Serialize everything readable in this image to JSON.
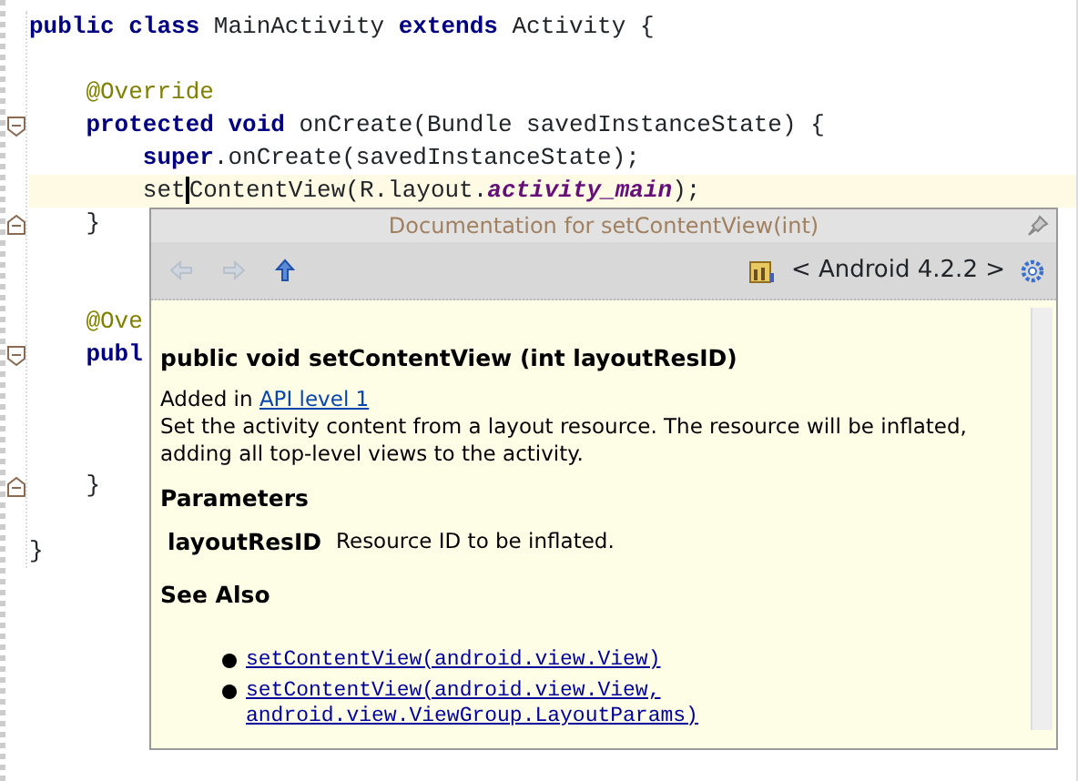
{
  "code_lines": [
    {
      "kind": "plain",
      "current": false,
      "tokens": [
        {
          "kind": "keyword",
          "text": "public class"
        },
        {
          "kind": "plain",
          "text": " MainActivity "
        },
        {
          "kind": "keyword",
          "text": "extends"
        },
        {
          "kind": "plain",
          "text": " Activity {"
        }
      ]
    },
    {
      "kind": "plain"
    },
    {
      "kind": "plain",
      "current": false,
      "tokens": [
        {
          "kind": "annotation",
          "text": "    @Override"
        }
      ]
    },
    {
      "kind": "fold-start",
      "current": false,
      "tokens": [
        {
          "kind": "keyword",
          "text": "    protected void"
        },
        {
          "kind": "plain",
          "text": " onCreate(Bundle savedInstanceState) {"
        }
      ]
    },
    {
      "kind": "plain",
      "current": false,
      "tokens": [
        {
          "kind": "keyword",
          "text": "        super"
        },
        {
          "kind": "plain",
          "text": ".onCreate(savedInstanceState);"
        }
      ]
    },
    {
      "kind": "plain",
      "current": true,
      "tokens": [
        {
          "kind": "plain",
          "text": "        set"
        },
        {
          "kind": "caret"
        },
        {
          "kind": "plain",
          "text": "ContentView(R.layout."
        },
        {
          "kind": "field",
          "text": "activity_main"
        },
        {
          "kind": "plain",
          "text": ");"
        }
      ]
    },
    {
      "kind": "fold-end",
      "current": false,
      "tokens": [
        {
          "kind": "plain",
          "text": "    }"
        }
      ]
    },
    {
      "kind": "plain"
    },
    {
      "kind": "plain"
    },
    {
      "kind": "plain",
      "current": false,
      "tokens": [
        {
          "kind": "annotation",
          "text": "    @Ove"
        }
      ]
    },
    {
      "kind": "fold-start",
      "current": false,
      "tokens": [
        {
          "kind": "keyword",
          "text": "    publ"
        }
      ]
    },
    {
      "kind": "plain"
    },
    {
      "kind": "plain"
    },
    {
      "kind": "plain"
    },
    {
      "kind": "fold-end",
      "current": false,
      "tokens": [
        {
          "kind": "plain",
          "text": "    }"
        }
      ]
    },
    {
      "kind": "plain"
    },
    {
      "kind": "plain",
      "current": false,
      "tokens": [
        {
          "kind": "plain",
          "text": "}"
        }
      ]
    }
  ],
  "doc_popup": {
    "title": "Documentation for setContentView(int)",
    "platform": "< Android 4.2.2 >",
    "signature": "public void setContentView (int layoutResID)",
    "added_in": "Added in",
    "added_link": "API level 1",
    "description": "Set the activity content from a layout resource. The resource will be inflated, adding all top-level views to the activity.",
    "parameters_heading": "Parameters",
    "parameters": [
      {
        "name": "layoutResID",
        "description": "Resource ID to be inflated."
      }
    ],
    "see_also_heading": "See Also",
    "see_also": [
      "setContentView(android.view.View)",
      "setContentView(android.view.View, android.view.ViewGroup.LayoutParams)"
    ]
  }
}
